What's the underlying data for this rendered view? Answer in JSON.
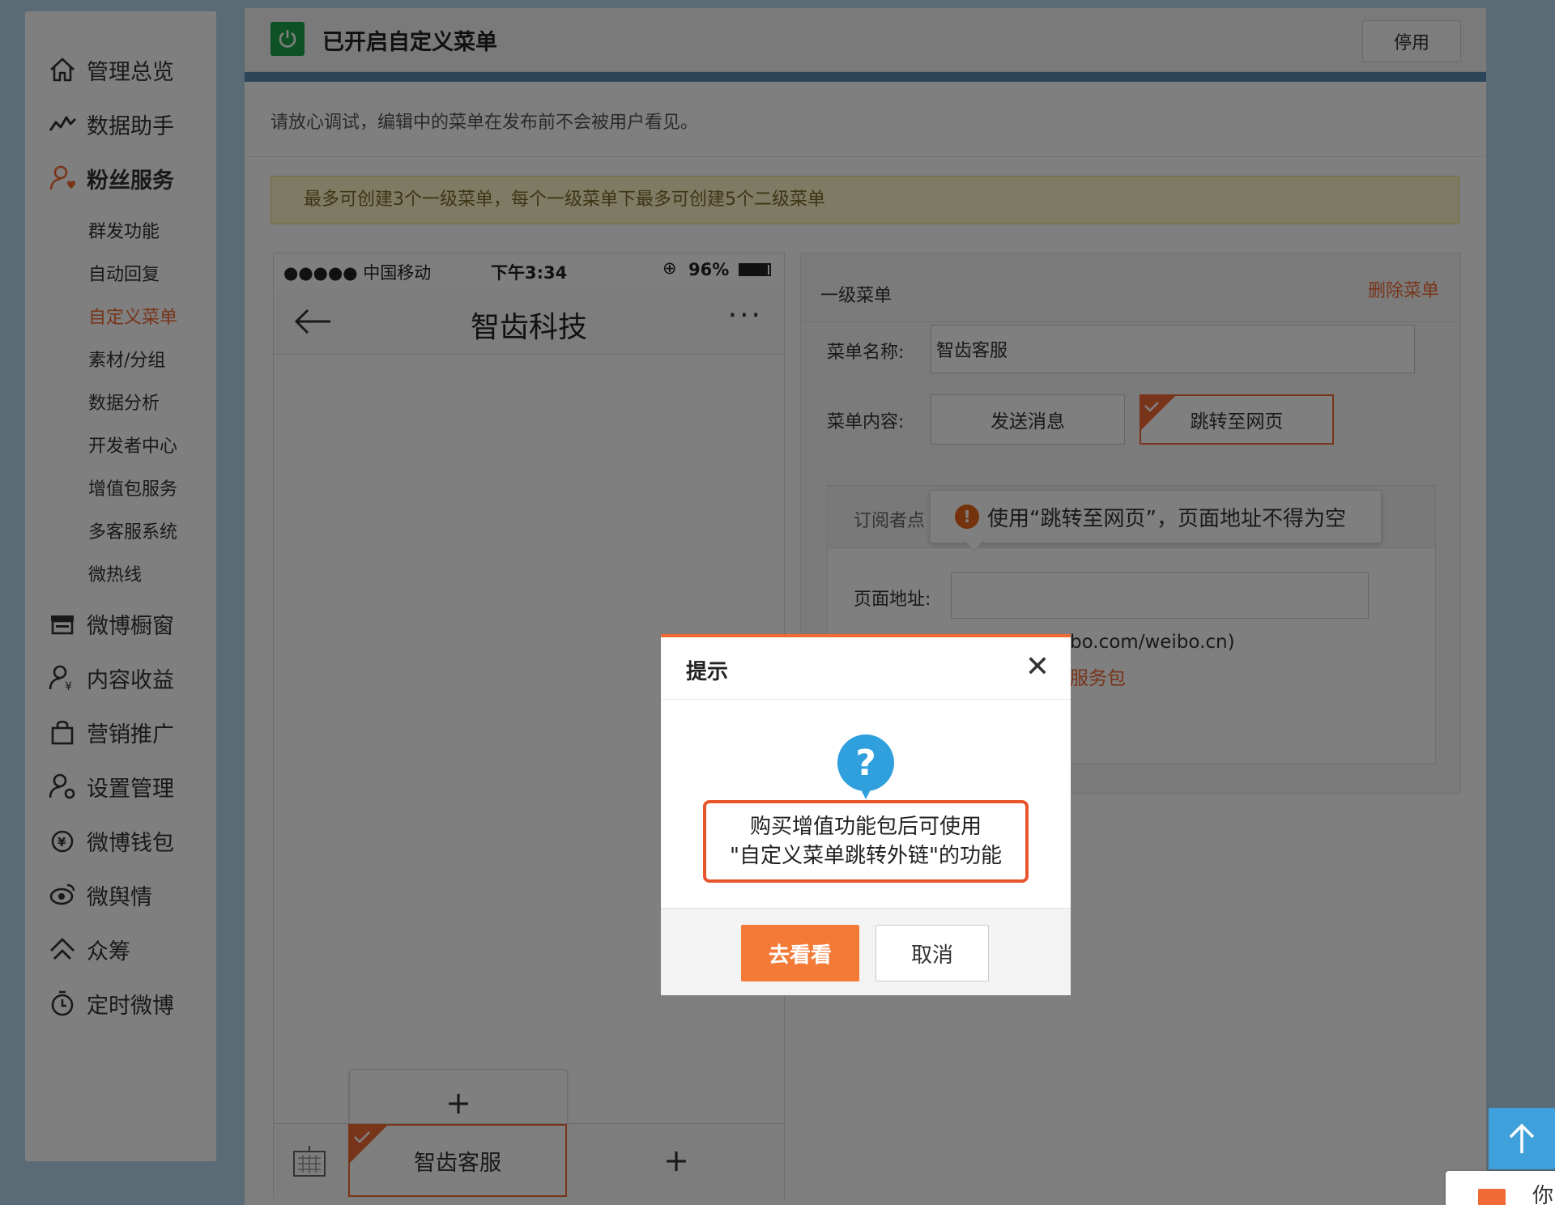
{
  "sidebar": {
    "main_items": [
      {
        "label": "管理总览",
        "icon": "home-icon"
      },
      {
        "label": "数据助手",
        "icon": "chart-line-icon"
      },
      {
        "label": "粉丝服务",
        "icon": "fans-icon"
      },
      {
        "label": "微博橱窗",
        "icon": "shop-icon"
      },
      {
        "label": "内容收益",
        "icon": "user-yen-icon"
      },
      {
        "label": "营销推广",
        "icon": "bag-icon"
      },
      {
        "label": "设置管理",
        "icon": "user-gear-icon"
      },
      {
        "label": "微博钱包",
        "icon": "wallet-icon"
      },
      {
        "label": "微舆情",
        "icon": "eye-icon"
      },
      {
        "label": "众筹",
        "icon": "crowdfund-icon"
      },
      {
        "label": "定时微博",
        "icon": "timer-icon"
      }
    ],
    "sub_items": [
      "群发功能",
      "自动回复",
      "自定义菜单",
      "素材/分组",
      "数据分析",
      "开发者中心",
      "增值包服务",
      "多客服系统",
      "微热线"
    ],
    "active_sub": "自定义菜单"
  },
  "header": {
    "title": "已开启自定义菜单",
    "stop_button": "停用",
    "hint": "请放心调试，编辑中的菜单在发布前不会被用户看见。",
    "notice": "最多可创建3个一级菜单，每个一级菜单下最多可创建5个二级菜单"
  },
  "phone": {
    "signal": "●●●●● 中国移动",
    "time": "下午3:34",
    "battery": "96%",
    "title": "智齿科技",
    "more": "···",
    "sub_add": "+",
    "menu_active": "智齿客服",
    "menu_add": "+"
  },
  "editor": {
    "title": "一级菜单",
    "delete": "删除菜单",
    "name_label": "菜单名称:",
    "name_value": "智齿客服",
    "content_label": "菜单内容:",
    "option_send": "发送消息",
    "option_jump": "跳转至网页",
    "subscriber_label": "订阅者点",
    "url_label": "页面地址:",
    "url_value": "",
    "partial_url_text": "bo.com/weibo.cn)",
    "partial_link_text": "服务包"
  },
  "tooltip": {
    "text": "使用“跳转至网页”，页面地址不得为空"
  },
  "dialog": {
    "title": "提示",
    "close": "✕",
    "icon_char": "?",
    "message_line1": "购买增值功能包后可使用",
    "message_line2": "\"自定义菜单跳转外链\"的功能",
    "confirm": "去看看",
    "cancel": "取消"
  },
  "floater": {
    "msg_text": "你"
  },
  "colors": {
    "accent": "#f06a35",
    "page_bg": "#b4d6ea",
    "success": "#1aa34a",
    "back_top": "#3fa1dc"
  }
}
